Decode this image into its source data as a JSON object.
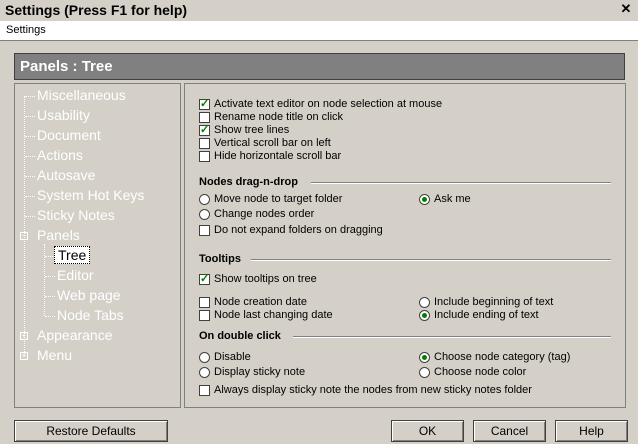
{
  "window": {
    "title": "Settings (Press F1 for help)",
    "close": "✕"
  },
  "menu": {
    "settings": "Settings"
  },
  "panel_header": "Panels : Tree",
  "tree": {
    "miscellaneous": "Miscellaneous",
    "usability": "Usability",
    "document": "Document",
    "actions": "Actions",
    "autosave": "Autosave",
    "system_hot_keys": "System Hot Keys",
    "sticky_notes": "Sticky Notes",
    "panels": "Panels",
    "tree": "Tree",
    "editor": "Editor",
    "web_page": "Web page",
    "node_tabs": "Node Tabs",
    "appearance": "Appearance",
    "menu": "Menu"
  },
  "general": {
    "activate_editor": "Activate text editor on node selection at mouse",
    "rename_title": "Rename node title on click",
    "show_tree_lines": "Show tree lines",
    "vertical_scroll": "Vertical scroll bar on left",
    "hide_horizontal": "Hide horizontale scroll bar"
  },
  "dnd": {
    "title": "Nodes drag-n-drop",
    "move_node": "Move node to target folder",
    "ask_me": "Ask me",
    "change_order": "Change nodes order",
    "no_expand": "Do not expand folders on dragging"
  },
  "tooltips": {
    "title": "Tooltips",
    "show_tooltips": "Show tooltips on tree",
    "creation_date": "Node creation date",
    "include_beginning": "Include beginning of text",
    "last_changing": "Node last changing date",
    "include_ending": "Include ending of text"
  },
  "double_click": {
    "title": "On double click",
    "disable": "Disable",
    "choose_category": "Choose node category (tag)",
    "display_sticky": "Display sticky note",
    "choose_color": "Choose node color",
    "always_display": "Always display sticky note the nodes from new sticky notes folder"
  },
  "buttons": {
    "restore": "Restore Defaults",
    "ok": "OK",
    "cancel": "Cancel",
    "help": "Help"
  }
}
